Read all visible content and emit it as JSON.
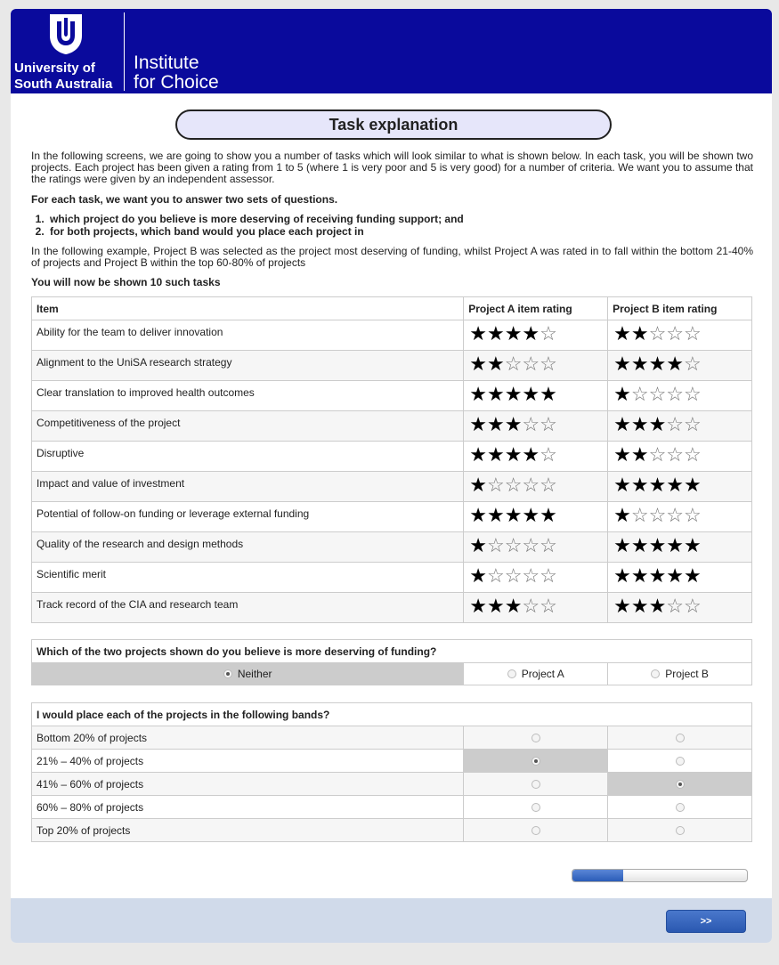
{
  "header": {
    "university_line1": "University of",
    "university_line2": "South Australia",
    "institute_line1": "Institute",
    "institute_line2": "for Choice"
  },
  "title": "Task explanation",
  "intro": {
    "p1": "In the following screens, we are going to show you a number of tasks which will look similar to what is shown below. In each task, you will be shown two projects. Each project has been given a rating from 1 to 5 (where 1 is very poor and 5 is very good) for a number of criteria. We want you to assume that the ratings were given by an independent assessor.",
    "p2": "For each task, we want you to answer two sets of questions.",
    "list": [
      "which project do you believe is more deserving of receiving funding support; and",
      "for both projects, which band would you place each project in"
    ],
    "p3": "In the following example, Project B was selected as the project most deserving of funding, whilst Project A was rated in to fall within the bottom 21-40% of projects and Project B within the top 60-80% of projects",
    "p4": "You will now be shown 10 such tasks"
  },
  "rating_table": {
    "headers": [
      "Item",
      "Project A item rating",
      "Project B item rating"
    ],
    "max_stars": 5,
    "rows": [
      {
        "item": "Ability for the team to deliver innovation",
        "a": 4,
        "b": 2
      },
      {
        "item": "Alignment to the UniSA research strategy",
        "a": 2,
        "b": 4
      },
      {
        "item": "Clear translation to improved health outcomes",
        "a": 5,
        "b": 1
      },
      {
        "item": "Competitiveness of the project",
        "a": 3,
        "b": 3
      },
      {
        "item": "Disruptive",
        "a": 4,
        "b": 2
      },
      {
        "item": "Impact and value of investment",
        "a": 1,
        "b": 5
      },
      {
        "item": "Potential of follow-on funding or leverage external funding",
        "a": 5,
        "b": 1
      },
      {
        "item": "Quality of the research and design methods",
        "a": 1,
        "b": 5
      },
      {
        "item": "Scientific merit",
        "a": 1,
        "b": 5
      },
      {
        "item": "Track record of the CIA and research team",
        "a": 3,
        "b": 3
      }
    ]
  },
  "question1": {
    "text": "Which of the two projects shown do you believe is more deserving of funding?",
    "options": [
      "Neither",
      "Project A",
      "Project B"
    ],
    "selected": "Neither"
  },
  "question2": {
    "text": "I would place each of the projects in the following bands?",
    "bands": [
      "Bottom 20% of projects",
      "21% – 40% of projects",
      "41% – 60% of projects",
      "60% – 80% of projects",
      "Top 20% of projects"
    ],
    "selected_a": 1,
    "selected_b": 2
  },
  "progress": 0.29,
  "footer": {
    "next_label": ">>"
  },
  "colors": {
    "header_bg": "#0a0a9c",
    "footer_bg": "#d0daea",
    "button": "#2a58b0"
  }
}
